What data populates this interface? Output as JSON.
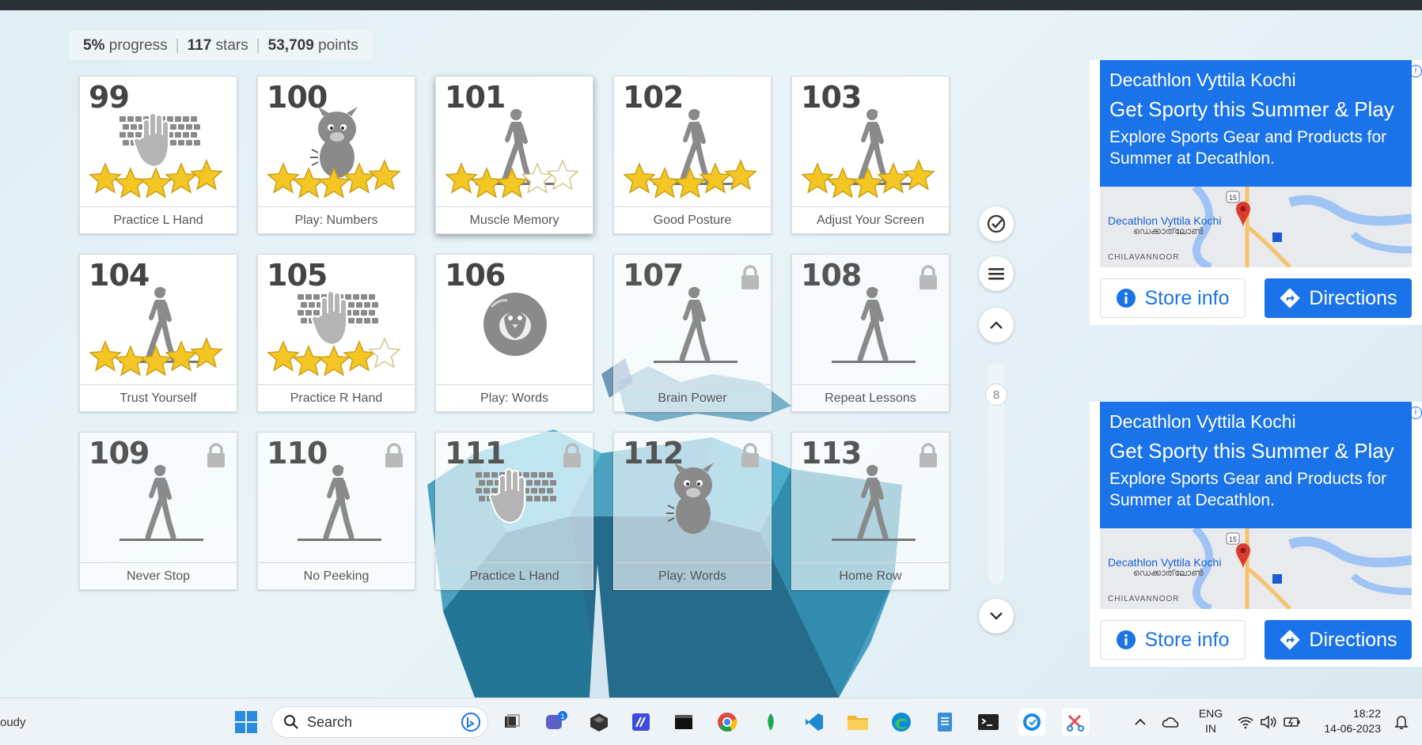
{
  "stats": {
    "progress_value": "5%",
    "progress_label": "progress",
    "stars_value": "117",
    "stars_label": "stars",
    "points_value": "53,709",
    "points_label": "points"
  },
  "lessons": [
    {
      "number": "99",
      "name": "Practice L Hand",
      "icon": "keyboard-hand-icon",
      "stars": 5,
      "locked": false
    },
    {
      "number": "100",
      "name": "Play: Numbers",
      "icon": "monster-icon",
      "stars": 5,
      "locked": false
    },
    {
      "number": "101",
      "name": "Muscle Memory",
      "icon": "walking-person-icon",
      "stars": 3,
      "locked": false
    },
    {
      "number": "102",
      "name": "Good Posture",
      "icon": "walking-person-icon",
      "stars": 5,
      "locked": false
    },
    {
      "number": "103",
      "name": "Adjust Your Screen",
      "icon": "walking-person-icon",
      "stars": 5,
      "locked": false
    },
    {
      "number": "104",
      "name": "Trust Yourself",
      "icon": "walking-person-icon",
      "stars": 5,
      "locked": false
    },
    {
      "number": "105",
      "name": "Practice R Hand",
      "icon": "keyboard-hand-icon",
      "stars": 4,
      "locked": false
    },
    {
      "number": "106",
      "name": "Play: Words",
      "icon": "penguin-bubble-icon",
      "stars": 0,
      "locked": false
    },
    {
      "number": "107",
      "name": "Brain Power",
      "icon": "walking-person-icon",
      "stars": 0,
      "locked": true
    },
    {
      "number": "108",
      "name": "Repeat Lessons",
      "icon": "walking-person-icon",
      "stars": 0,
      "locked": true
    },
    {
      "number": "109",
      "name": "Never Stop",
      "icon": "walking-person-icon",
      "stars": 0,
      "locked": true
    },
    {
      "number": "110",
      "name": "No Peeking",
      "icon": "walking-person-icon",
      "stars": 0,
      "locked": true
    },
    {
      "number": "111",
      "name": "Practice L Hand",
      "icon": "keyboard-hand-icon",
      "stars": 0,
      "locked": true
    },
    {
      "number": "112",
      "name": "Play: Words",
      "icon": "monster-icon",
      "stars": 0,
      "locked": true
    },
    {
      "number": "113",
      "name": "Home Row",
      "icon": "walking-person-icon",
      "stars": 0,
      "locked": true
    }
  ],
  "sidebar": {
    "page_number": "8",
    "buttons": [
      "check-circle-icon",
      "menu-icon",
      "chevron-up-icon",
      "chevron-down-icon"
    ]
  },
  "ads": [
    {
      "advertiser": "Decathlon Vyttila Kochi",
      "headline": "Get Sporty this Summer & Play",
      "body": "Explore Sports Gear and Products for Summer at Decathlon.",
      "map_label": "Decathlon Vyttila Kochi",
      "map_sublabel": "ഡെക്കാത്‌ലോൺ",
      "map_area": "CHILAVANNOOR",
      "map_road": "15",
      "store_info": "Store info",
      "directions": "Directions"
    },
    {
      "advertiser": "Decathlon Vyttila Kochi",
      "headline": "Get Sporty this Summer & Play",
      "body": "Explore Sports Gear and Products for Summer at Decathlon.",
      "map_label": "Decathlon Vyttila Kochi",
      "map_sublabel": "ഡെക്കാത്‌ലോൺ",
      "map_area": "CHILAVANNOOR",
      "map_road": "15",
      "store_info": "Store info",
      "directions": "Directions"
    }
  ],
  "taskbar": {
    "weather": "oudy",
    "search_placeholder": "Search",
    "chat_badge": "1",
    "lang_line1": "ENG",
    "lang_line2": "IN",
    "time": "18:22",
    "date": "14-06-2023"
  },
  "colors": {
    "star_gold": "#f3c623",
    "ad_blue": "#1a73e8",
    "icon_gray": "#8a8a8a"
  }
}
